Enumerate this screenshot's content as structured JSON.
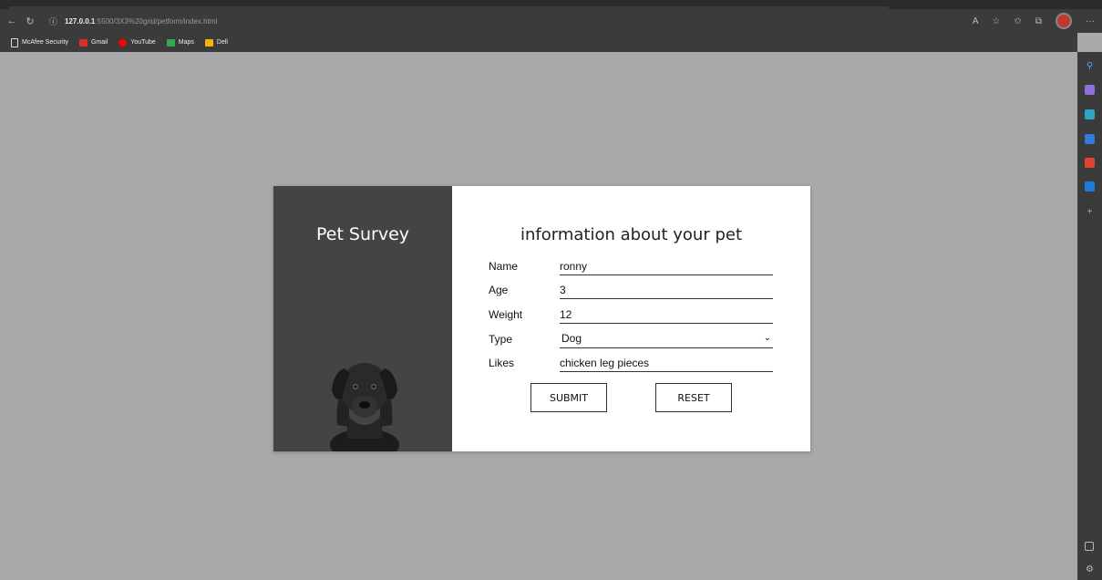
{
  "browser": {
    "url_host": "127.0.0.1",
    "url_path": ":5500/3X3%20grid/petform/index.html",
    "bookmarks": [
      {
        "label": "McAfee Security",
        "color": "#dddddd"
      },
      {
        "label": "Gmail",
        "color": "#d93025"
      },
      {
        "label": "YouTube",
        "color": "#ff0000"
      },
      {
        "label": "Maps",
        "color": "#34a853"
      },
      {
        "label": "Dell",
        "color": "#f4b400"
      }
    ]
  },
  "survey": {
    "panel_title": "Pet Survey",
    "form_title": "information about your pet",
    "fields": [
      {
        "label": "Name",
        "value": "ronny"
      },
      {
        "label": "Age",
        "value": "3"
      },
      {
        "label": "Weight",
        "value": "12"
      },
      {
        "label": "Type",
        "value": "Dog"
      },
      {
        "label": "Likes",
        "value": "chicken leg pieces"
      }
    ],
    "submit_label": "SUBMIT",
    "reset_label": "RESET"
  }
}
